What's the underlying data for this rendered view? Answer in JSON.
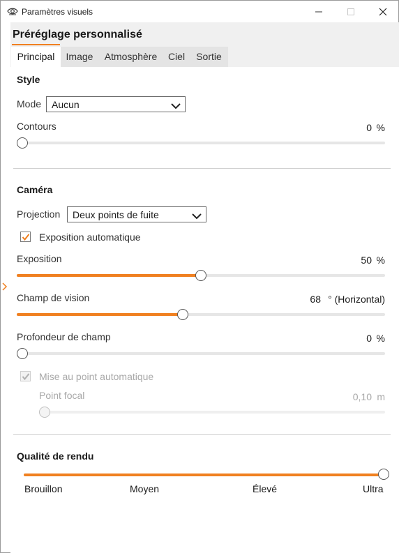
{
  "window": {
    "title": "Paramètres visuels"
  },
  "preset": {
    "title": "Préréglage personnalisé"
  },
  "tabs": [
    {
      "label": "Principal",
      "active": true
    },
    {
      "label": "Image",
      "active": false
    },
    {
      "label": "Atmosphère",
      "active": false
    },
    {
      "label": "Ciel",
      "active": false
    },
    {
      "label": "Sortie",
      "active": false
    }
  ],
  "style": {
    "heading": "Style",
    "mode_label": "Mode",
    "mode_value": "Aucun",
    "contours_label": "Contours",
    "contours_value": "0",
    "contours_unit": "%",
    "contours_fraction": 0
  },
  "camera": {
    "heading": "Caméra",
    "projection_label": "Projection",
    "projection_value": "Deux points de fuite",
    "auto_exposure_label": "Exposition automatique",
    "auto_exposure_checked": true,
    "exposure_label": "Exposition",
    "exposure_value": "50",
    "exposure_unit": "%",
    "exposure_fraction": 0.5,
    "fov_label": "Champ de vision",
    "fov_value": "68",
    "fov_unit": "° (Horizontal)",
    "fov_fraction": 0.45,
    "dof_label": "Profondeur de champ",
    "dof_value": "0",
    "dof_unit": "%",
    "dof_fraction": 0,
    "autofocus_label": "Mise au point automatique",
    "autofocus_checked": true,
    "focal_label": "Point focal",
    "focal_value": "0,10",
    "focal_unit": "m",
    "focal_fraction": 0
  },
  "render_quality": {
    "heading": "Qualité de rendu",
    "levels": [
      "Brouillon",
      "Moyen",
      "Élevé",
      "Ultra"
    ],
    "selected": "Ultra",
    "fraction": 1
  },
  "colors": {
    "accent": "#f08020"
  }
}
